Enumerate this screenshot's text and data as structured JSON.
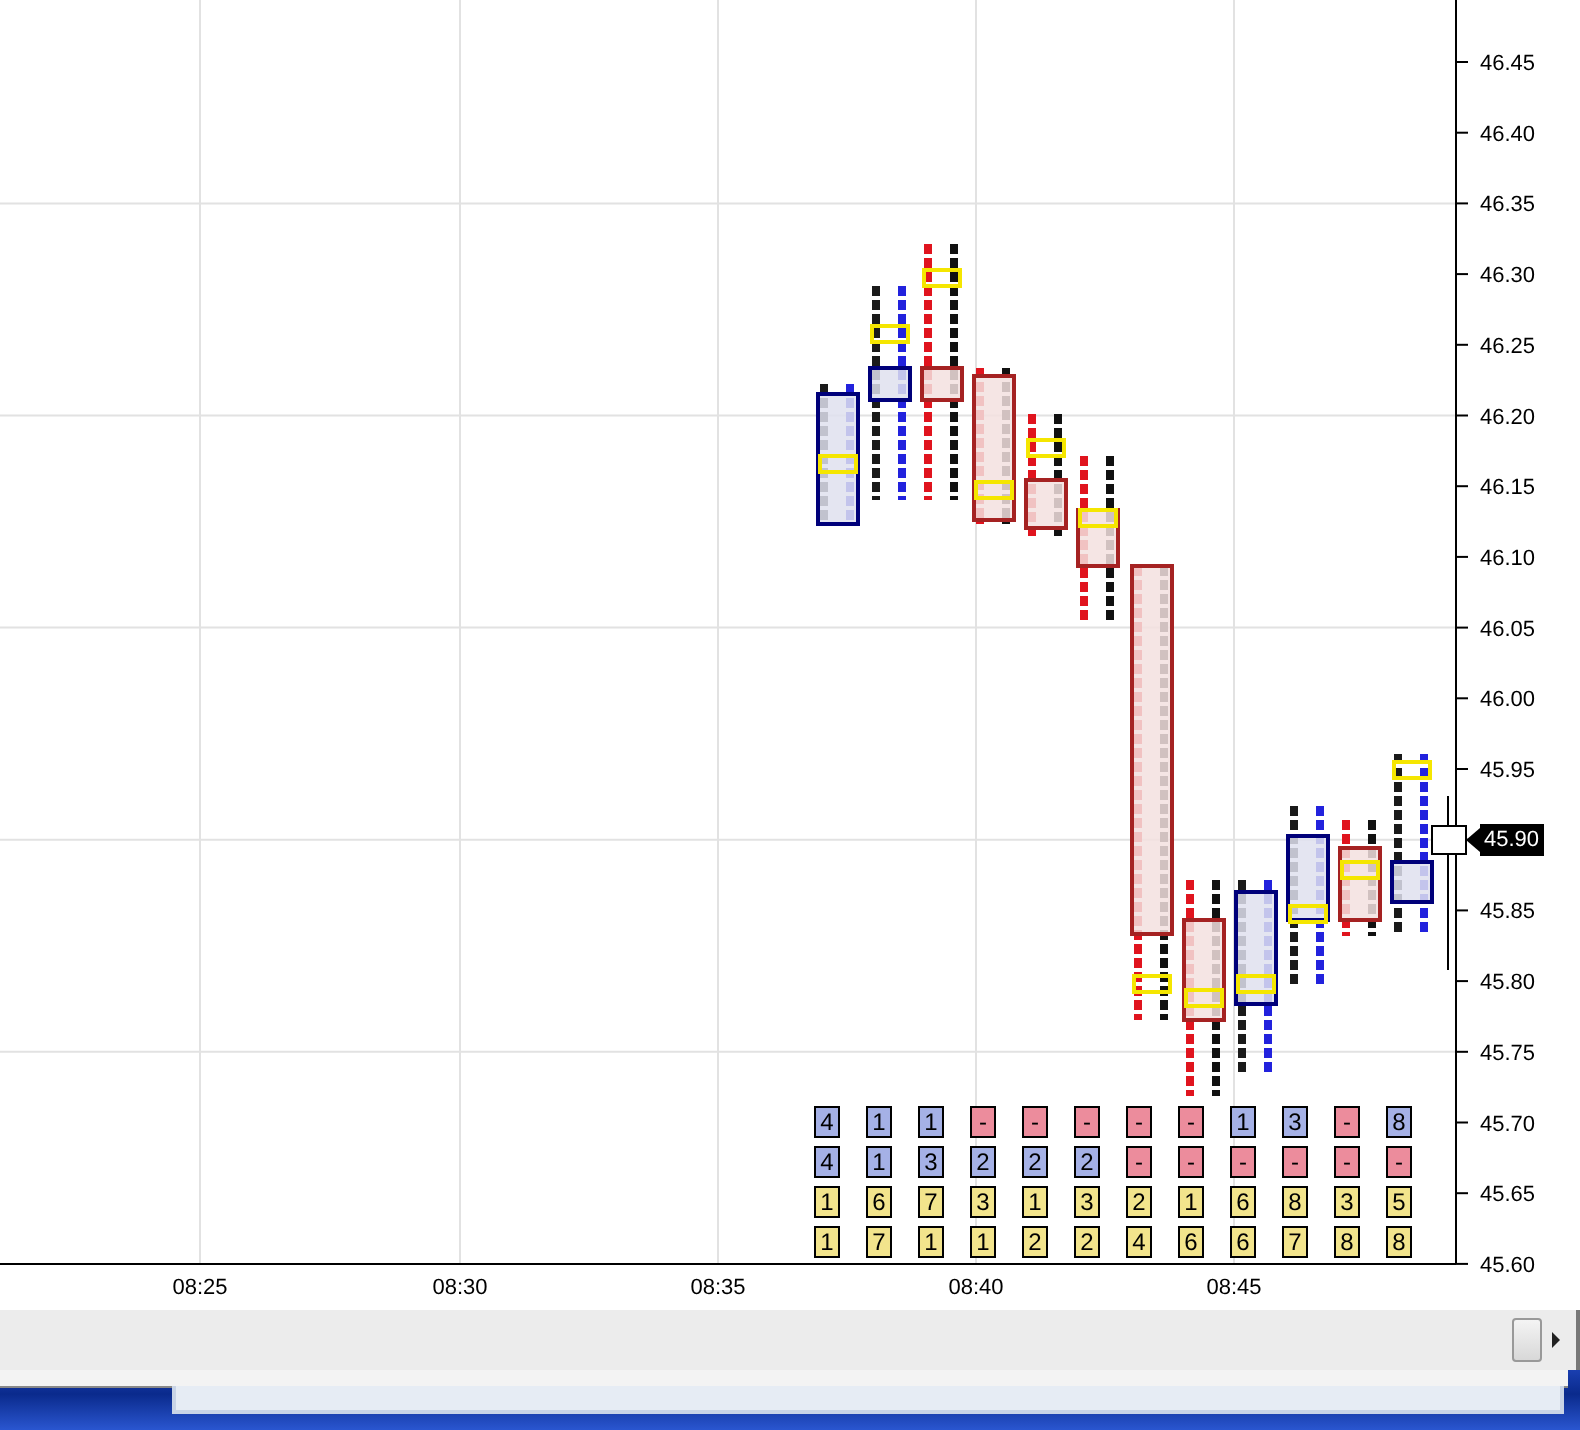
{
  "y_axis": {
    "labels": [
      {
        "text": "46.45",
        "current": false
      },
      {
        "text": "46.40",
        "current": false
      },
      {
        "text": "46.35",
        "current": false
      },
      {
        "text": "46.30",
        "current": false
      },
      {
        "text": "46.25",
        "current": false
      },
      {
        "text": "46.20",
        "current": false
      },
      {
        "text": "46.15",
        "current": false
      },
      {
        "text": "46.10",
        "current": false
      },
      {
        "text": "46.05",
        "current": false
      },
      {
        "text": "46.00",
        "current": false
      },
      {
        "text": "45.95",
        "current": false
      },
      {
        "text": "45.90",
        "current": true
      },
      {
        "text": "45.85",
        "current": false
      },
      {
        "text": "45.80",
        "current": false
      },
      {
        "text": "45.75",
        "current": false
      },
      {
        "text": "45.70",
        "current": false
      },
      {
        "text": "45.65",
        "current": false
      },
      {
        "text": "45.60",
        "current": false
      }
    ]
  },
  "x_axis": {
    "labels": [
      "08:25",
      "08:30",
      "08:35",
      "08:40",
      "08:45"
    ]
  },
  "stats_rows": [
    {
      "cells": [
        {
          "value": "4",
          "color": "#a5b1e6"
        },
        {
          "value": "1",
          "color": "#a5b1e6"
        },
        {
          "value": "1",
          "color": "#a5b1e6"
        },
        {
          "value": "-",
          "color": "#ec8c9c"
        },
        {
          "value": "-",
          "color": "#ec8c9c"
        },
        {
          "value": "-",
          "color": "#ec8c9c"
        },
        {
          "value": "-",
          "color": "#ec8c9c"
        },
        {
          "value": "-",
          "color": "#ec8c9c"
        },
        {
          "value": "1",
          "color": "#a5b1e6"
        },
        {
          "value": "3",
          "color": "#a5b1e6"
        },
        {
          "value": "-",
          "color": "#ec8c9c"
        },
        {
          "value": "8",
          "color": "#a5b1e6"
        }
      ]
    },
    {
      "cells": [
        {
          "value": "4",
          "color": "#a5b1e6"
        },
        {
          "value": "1",
          "color": "#a5b1e6"
        },
        {
          "value": "3",
          "color": "#a5b1e6"
        },
        {
          "value": "2",
          "color": "#a5b1e6"
        },
        {
          "value": "2",
          "color": "#a5b1e6"
        },
        {
          "value": "2",
          "color": "#a5b1e6"
        },
        {
          "value": "-",
          "color": "#ec8c9c"
        },
        {
          "value": "-",
          "color": "#ec8c9c"
        },
        {
          "value": "-",
          "color": "#ec8c9c"
        },
        {
          "value": "-",
          "color": "#ec8c9c"
        },
        {
          "value": "-",
          "color": "#ec8c9c"
        },
        {
          "value": "-",
          "color": "#ec8c9c"
        }
      ]
    },
    {
      "cells": [
        {
          "value": "1",
          "color": "#f2e48c"
        },
        {
          "value": "6",
          "color": "#f2e48c"
        },
        {
          "value": "7",
          "color": "#f2e48c"
        },
        {
          "value": "3",
          "color": "#f2e48c"
        },
        {
          "value": "1",
          "color": "#f2e48c"
        },
        {
          "value": "3",
          "color": "#f2e48c"
        },
        {
          "value": "2",
          "color": "#f2e48c"
        },
        {
          "value": "1",
          "color": "#f2e48c"
        },
        {
          "value": "6",
          "color": "#f2e48c"
        },
        {
          "value": "8",
          "color": "#f2e48c"
        },
        {
          "value": "3",
          "color": "#f2e48c"
        },
        {
          "value": "5",
          "color": "#f2e48c"
        }
      ]
    },
    {
      "cells": [
        {
          "value": "1",
          "color": "#f2e48c"
        },
        {
          "value": "7",
          "color": "#f2e48c"
        },
        {
          "value": "1",
          "color": "#f2e48c"
        },
        {
          "value": "1",
          "color": "#f2e48c"
        },
        {
          "value": "2",
          "color": "#f2e48c"
        },
        {
          "value": "2",
          "color": "#f2e48c"
        },
        {
          "value": "4",
          "color": "#f2e48c"
        },
        {
          "value": "6",
          "color": "#f2e48c"
        },
        {
          "value": "6",
          "color": "#f2e48c"
        },
        {
          "value": "7",
          "color": "#f2e48c"
        },
        {
          "value": "8",
          "color": "#f2e48c"
        },
        {
          "value": "8",
          "color": "#f2e48c"
        }
      ]
    }
  ]
}
